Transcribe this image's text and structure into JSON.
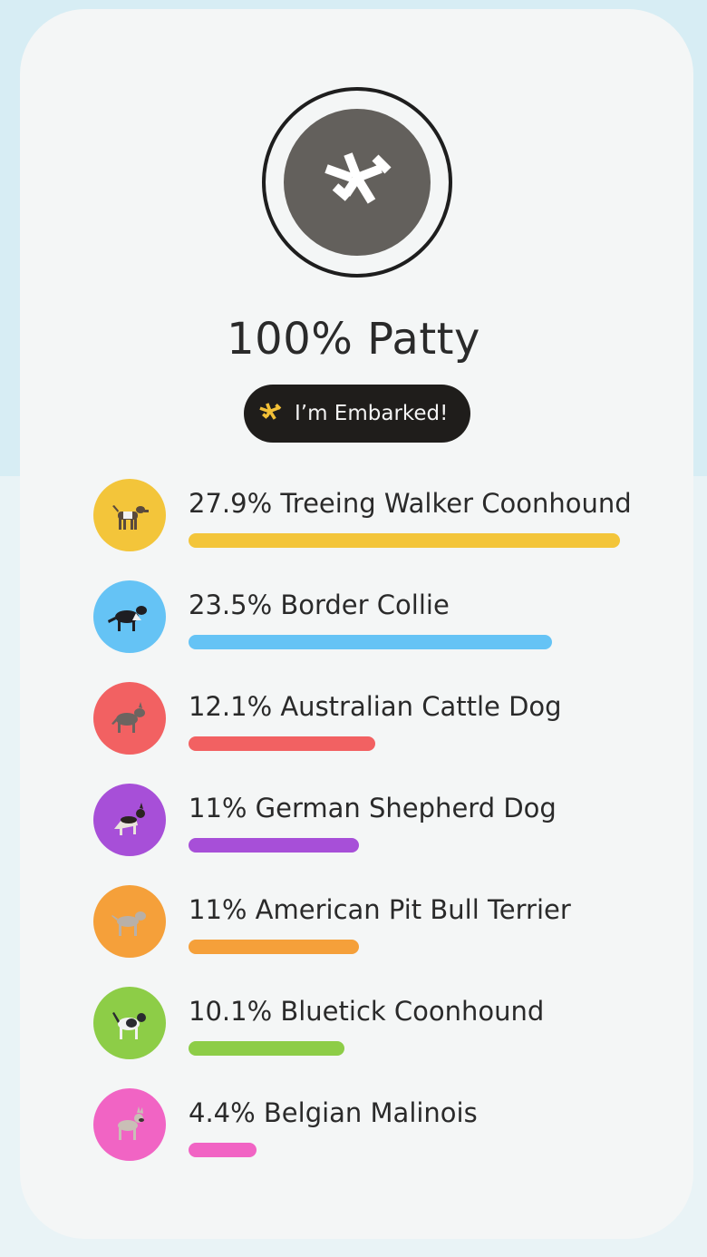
{
  "profile": {
    "name": "100% Patty",
    "avatar_color": "#63605c",
    "avatar_icon": "embark-logo-icon"
  },
  "badge": {
    "label": "I’m Embarked!",
    "icon": "embark-logo-icon",
    "icon_color": "#f2c037"
  },
  "breeds": [
    {
      "label": "27.9% Treeing Walker Coonhound",
      "percent": 27.9,
      "color": "#f3c53a",
      "icon": "dog-icon"
    },
    {
      "label": "23.5% Border Collie",
      "percent": 23.5,
      "color": "#65c3f5",
      "icon": "dog-icon"
    },
    {
      "label": "12.1% Australian Cattle Dog",
      "percent": 12.1,
      "color": "#f26162",
      "icon": "dog-icon"
    },
    {
      "label": "11% German Shepherd Dog",
      "percent": 11,
      "color": "#a74fd8",
      "icon": "dog-icon"
    },
    {
      "label": "11% American Pit Bull Terrier",
      "percent": 11,
      "color": "#f5a03a",
      "icon": "dog-icon"
    },
    {
      "label": "10.1% Bluetick Coonhound",
      "percent": 10.1,
      "color": "#8dcd47",
      "icon": "dog-icon"
    },
    {
      "label": "4.4% Belgian Malinois",
      "percent": 4.4,
      "color": "#f164c4",
      "icon": "dog-icon"
    }
  ]
}
